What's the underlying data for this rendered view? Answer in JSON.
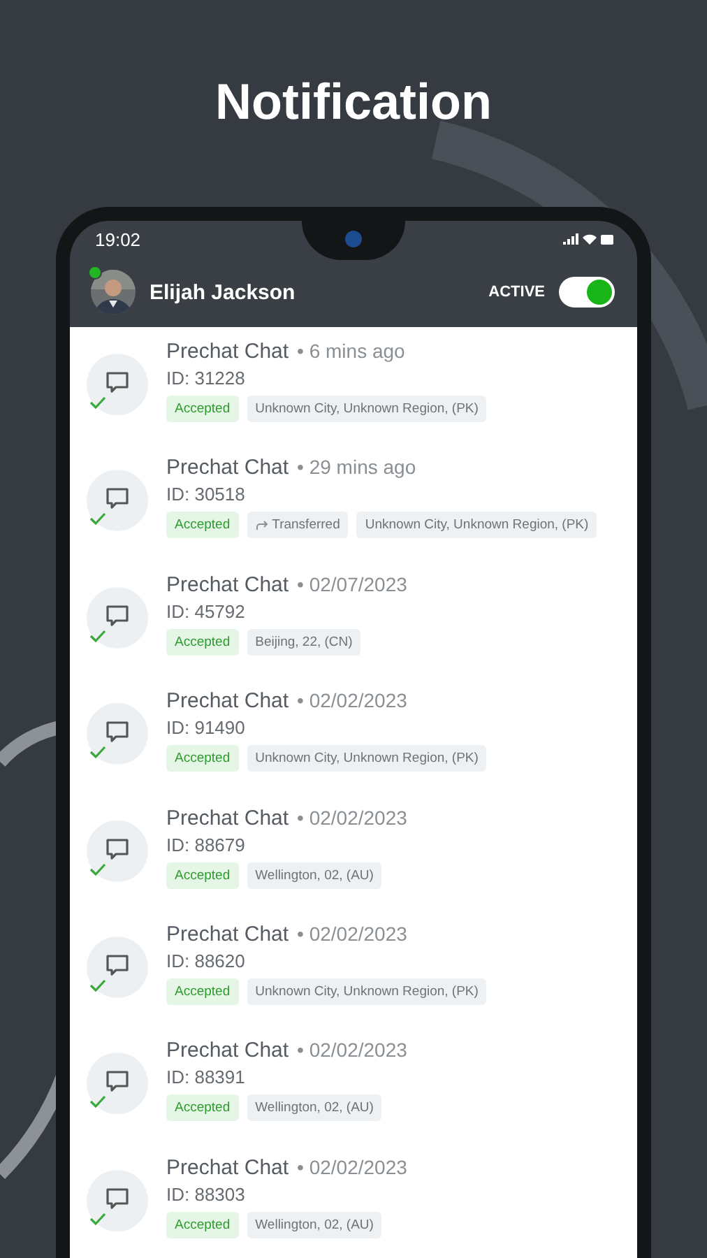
{
  "page_title": "Notification",
  "status_bar": {
    "time": "19:02"
  },
  "header": {
    "user_name": "Elijah Jackson",
    "online": true,
    "toggle_label": "ACTIVE",
    "active": true
  },
  "notifications": [
    {
      "title": "Prechat Chat",
      "time": "• 6 mins ago",
      "id": "ID: 31228",
      "accepted": true,
      "tags": [
        {
          "kind": "status",
          "text": "Accepted"
        },
        {
          "kind": "location",
          "text": "Unknown City, Unknown Region, (PK)"
        }
      ]
    },
    {
      "title": "Prechat Chat",
      "time": "• 29 mins ago",
      "id": "ID: 30518",
      "accepted": true,
      "tags": [
        {
          "kind": "status",
          "text": "Accepted"
        },
        {
          "kind": "transfer",
          "text": "Transferred"
        },
        {
          "kind": "location",
          "text": "Unknown City, Unknown Region, (PK)"
        }
      ]
    },
    {
      "title": "Prechat Chat",
      "time": "• 02/07/2023",
      "id": "ID: 45792",
      "accepted": true,
      "tags": [
        {
          "kind": "status",
          "text": "Accepted"
        },
        {
          "kind": "location",
          "text": "Beijing, 22, (CN)"
        }
      ]
    },
    {
      "title": "Prechat Chat",
      "time": "• 02/02/2023",
      "id": "ID: 91490",
      "accepted": true,
      "tags": [
        {
          "kind": "status",
          "text": "Accepted"
        },
        {
          "kind": "location",
          "text": "Unknown City, Unknown Region, (PK)"
        }
      ]
    },
    {
      "title": "Prechat Chat",
      "time": "• 02/02/2023",
      "id": "ID: 88679",
      "accepted": true,
      "tags": [
        {
          "kind": "status",
          "text": "Accepted"
        },
        {
          "kind": "location",
          "text": "Wellington, 02, (AU)"
        }
      ]
    },
    {
      "title": "Prechat Chat",
      "time": "• 02/02/2023",
      "id": "ID: 88620",
      "accepted": true,
      "tags": [
        {
          "kind": "status",
          "text": "Accepted"
        },
        {
          "kind": "location",
          "text": "Unknown City, Unknown Region, (PK)"
        }
      ]
    },
    {
      "title": "Prechat Chat",
      "time": "• 02/02/2023",
      "id": "ID: 88391",
      "accepted": true,
      "tags": [
        {
          "kind": "status",
          "text": "Accepted"
        },
        {
          "kind": "location",
          "text": "Wellington, 02, (AU)"
        }
      ]
    },
    {
      "title": "Prechat Chat",
      "time": "• 02/02/2023",
      "id": "ID: 88303",
      "accepted": true,
      "tags": [
        {
          "kind": "status",
          "text": "Accepted"
        },
        {
          "kind": "location",
          "text": "Wellington, 02, (AU)"
        }
      ]
    }
  ]
}
